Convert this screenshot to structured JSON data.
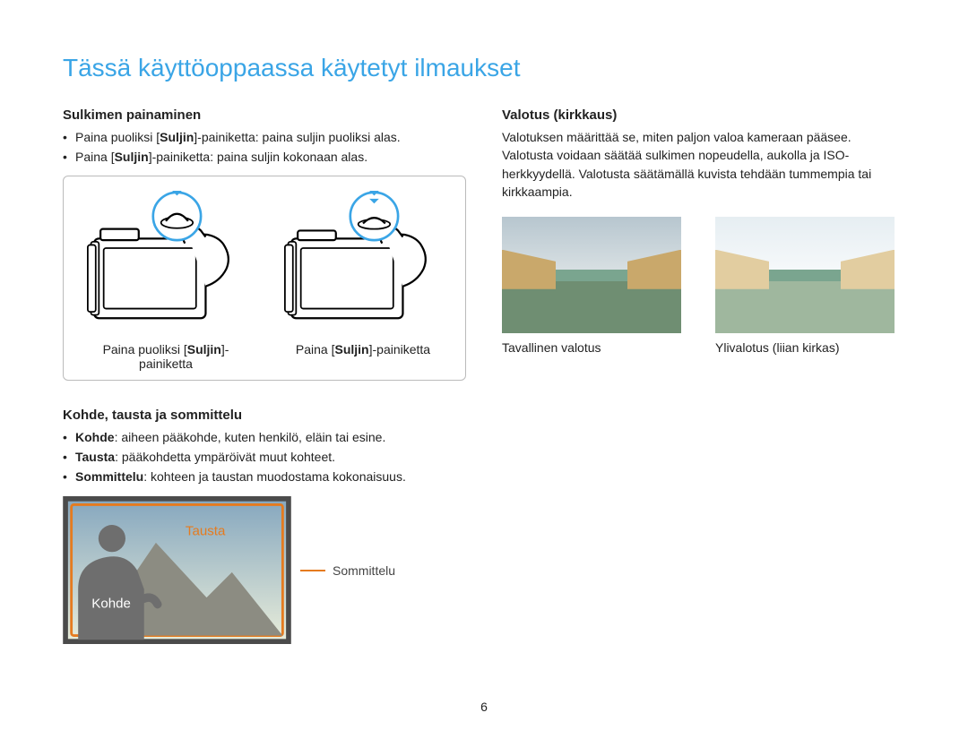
{
  "title": "Tässä käyttöoppaassa käytetyt ilmaukset",
  "left": {
    "shutter": {
      "heading": "Sulkimen painaminen",
      "item1_pre": "Paina puoliksi [",
      "item1_bold": "Suljin",
      "item1_post": "]-painiketta: paina suljin puoliksi alas.",
      "item2_pre": "Paina [",
      "item2_bold": "Suljin",
      "item2_post": "]-painiketta: paina suljin kokonaan alas.",
      "caption1_pre": "Paina puoliksi [",
      "caption1_bold": "Suljin",
      "caption1_post": "]-painiketta",
      "caption2_pre": "Paina [",
      "caption2_bold": "Suljin",
      "caption2_post": "]-painiketta"
    },
    "composition": {
      "heading": "Kohde, tausta ja sommittelu",
      "item1_bold": "Kohde",
      "item1_rest": ": aiheen pääkohde, kuten henkilö, eläin tai esine.",
      "item2_bold": "Tausta",
      "item2_rest": ": pääkohdetta ympäröivät muut kohteet.",
      "item3_bold": "Sommittelu",
      "item3_rest": ": kohteen ja taustan muodostama kokonaisuus.",
      "label_tausta": "Tausta",
      "label_kohde": "Kohde",
      "label_sommittelu": "Sommittelu"
    }
  },
  "right": {
    "exposure": {
      "heading": "Valotus (kirkkaus)",
      "para": "Valotuksen määrittää se, miten paljon valoa kameraan pääsee. Valotusta voidaan säätää sulkimen nopeudella, aukolla ja ISO-herkkyydellä. Valotusta säätämällä kuvista tehdään tummempia tai kirkkaampia.",
      "caption_normal": "Tavallinen valotus",
      "caption_over": "Ylivalotus (liian kirkas)"
    }
  },
  "page_number": "6"
}
